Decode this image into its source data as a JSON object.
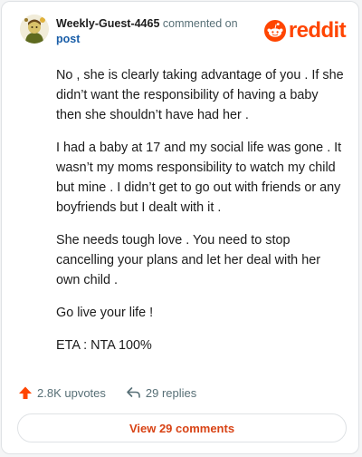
{
  "comment": {
    "username": "Weekly-Guest-4465",
    "action_text": "commented on",
    "target_text": "post",
    "brand": "reddit",
    "paragraphs": [
      "No , she is clearly taking advantage of you . If she didn’t want the responsibility of having a baby then she shouldn’t have had her .",
      "I had a baby at 17 and my social life was gone . It wasn’t my moms responsibility to watch my child but mine . I didn’t get to go out with friends or any boyfriends but I dealt with it .",
      "She needs tough love . You need to stop cancelling your plans and let her deal with her own child .",
      "Go live your life !",
      "ETA : NTA 100%"
    ]
  },
  "footer": {
    "upvotes": "2.8K upvotes",
    "replies": "29 replies",
    "view_button": "View 29 comments"
  },
  "icons": {
    "upvote": "upvote-arrow-icon",
    "reply": "reply-arrow-icon",
    "logo": "reddit-snoo-icon"
  },
  "colors": {
    "brand": "#ff4500",
    "link": "#1a5ea8",
    "view_button_text": "#d84315"
  }
}
